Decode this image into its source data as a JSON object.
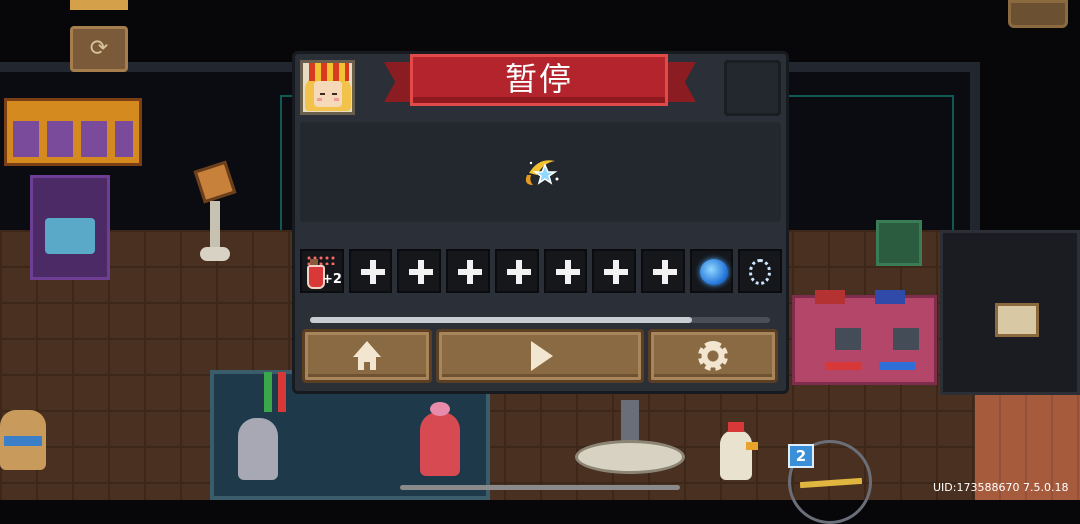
{
  "pause_menu": {
    "title": "暂停",
    "character_portrait": "portrait-icon",
    "buff_icon": "star-buff-icon",
    "slots": [
      {
        "type": "potion",
        "icon": "potion-plus2-icon",
        "badge": "+2"
      },
      {
        "type": "empty",
        "icon": "plus-icon"
      },
      {
        "type": "empty",
        "icon": "plus-icon"
      },
      {
        "type": "empty",
        "icon": "plus-icon"
      },
      {
        "type": "empty",
        "icon": "plus-icon"
      },
      {
        "type": "empty",
        "icon": "plus-icon"
      },
      {
        "type": "empty",
        "icon": "plus-icon"
      },
      {
        "type": "empty",
        "icon": "plus-icon"
      },
      {
        "type": "talent",
        "icon": "brain-icon"
      },
      {
        "type": "talent",
        "icon": "ring-icon"
      }
    ],
    "progress_fraction": 0.83,
    "buttons": {
      "home": "home-icon",
      "resume": "play-icon",
      "settings": "gear-icon"
    },
    "colors": {
      "ribbon": "#b3242c",
      "panel": "#2b3038",
      "button": "#8a6a42"
    }
  },
  "hud": {
    "uid_text": "UID:173588670 7.5.0.18",
    "weapon_badge": "2"
  }
}
